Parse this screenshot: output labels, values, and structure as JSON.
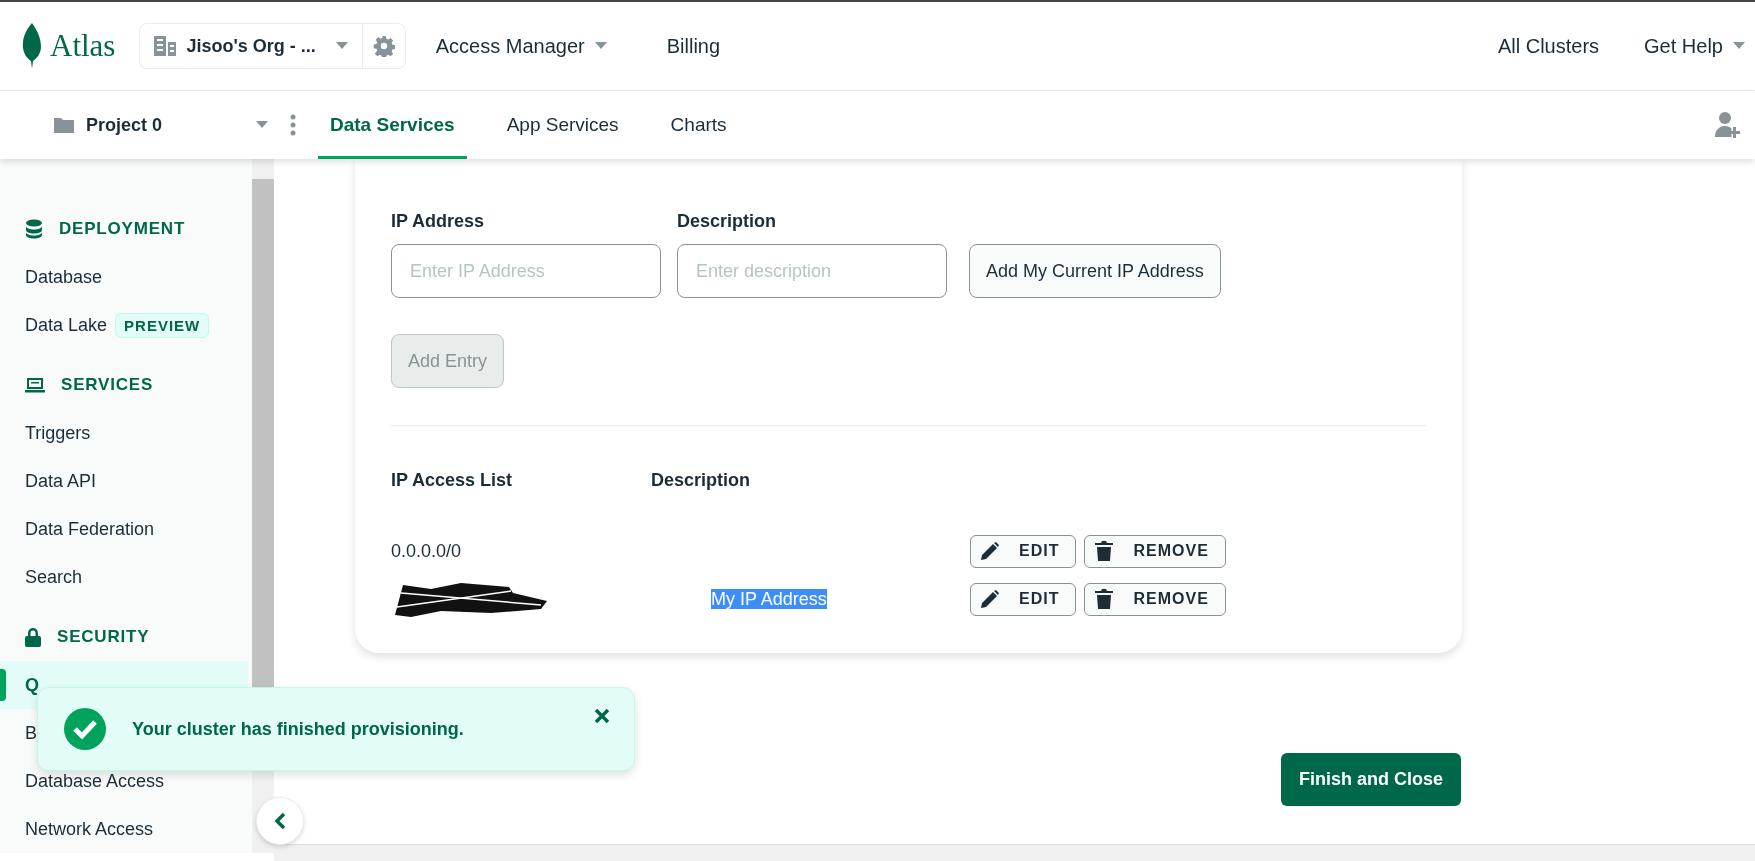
{
  "header": {
    "logo": "Atlas",
    "org": "Jisoo's Org - ...",
    "nav": [
      {
        "label": "Access Manager",
        "dropdown": true
      },
      {
        "label": "Billing",
        "dropdown": false
      }
    ],
    "right": [
      {
        "label": "All Clusters",
        "dropdown": false
      },
      {
        "label": "Get Help",
        "dropdown": true
      }
    ]
  },
  "subnav": {
    "project": "Project 0",
    "tabs": [
      {
        "label": "Data Services",
        "selected": true
      },
      {
        "label": "App Services",
        "selected": false
      },
      {
        "label": "Charts",
        "selected": false
      }
    ]
  },
  "sidebar": {
    "sections": [
      {
        "title": "DEPLOYMENT",
        "items": [
          {
            "label": "Database",
            "selected": false
          },
          {
            "label": "Data Lake",
            "badge": "PREVIEW",
            "selected": false
          }
        ]
      },
      {
        "title": "SERVICES",
        "items": [
          {
            "label": "Triggers",
            "selected": false
          },
          {
            "label": "Data API",
            "selected": false
          },
          {
            "label": "Data Federation",
            "selected": false
          },
          {
            "label": "Search",
            "selected": false
          }
        ]
      },
      {
        "title": "SECURITY",
        "items": [
          {
            "label": "Q",
            "selected": true
          },
          {
            "label": "B",
            "selected": false
          },
          {
            "label": "Database Access",
            "selected": false
          },
          {
            "label": "Network Access",
            "selected": false
          }
        ]
      }
    ]
  },
  "form": {
    "ip_label": "IP Address",
    "ip_placeholder": "Enter IP Address",
    "desc_label": "Description",
    "desc_placeholder": "Enter description",
    "add_current": "Add My Current IP Address",
    "add_entry": {
      "label": "Add Entry",
      "disabled": true
    }
  },
  "access_list": {
    "columns": [
      "IP Access List",
      "Description"
    ],
    "rows": [
      {
        "ip": "0.0.0.0/0",
        "redacted": false,
        "edit": "EDIT",
        "remove": "REMOVE"
      },
      {
        "redacted": true,
        "description": "My IP Address",
        "highlighted": true,
        "edit": "EDIT",
        "remove": "REMOVE"
      }
    ]
  },
  "finish_button": "Finish and Close",
  "toast": {
    "message": "Your cluster has finished provisioning."
  }
}
